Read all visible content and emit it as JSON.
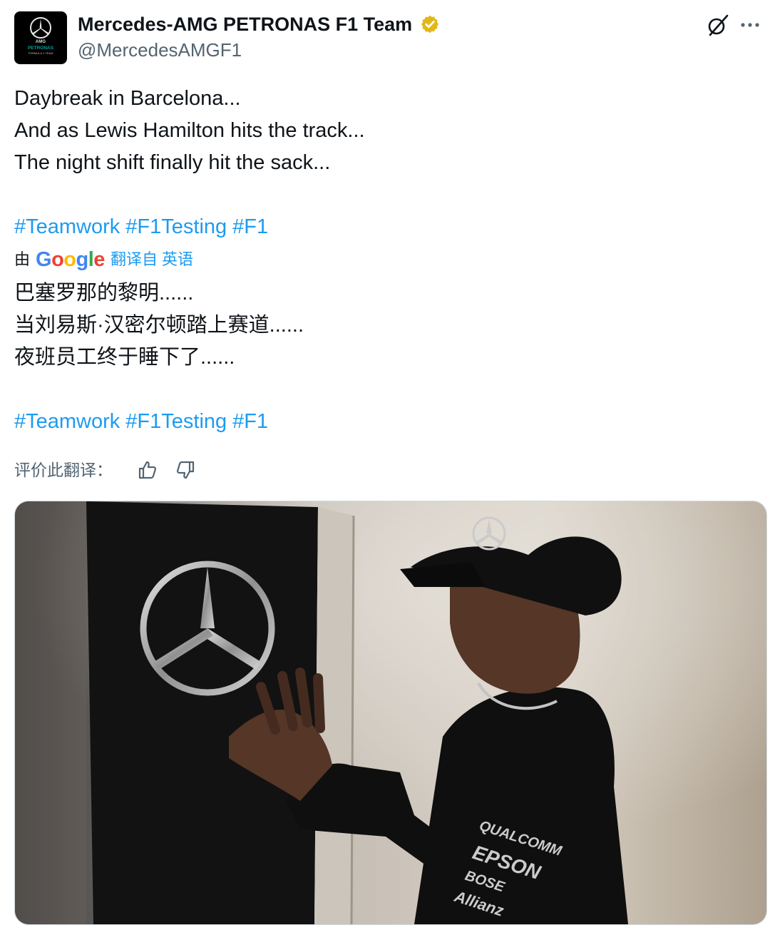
{
  "account": {
    "display_name": "Mercedes-AMG PETRONAS F1 Team",
    "handle": "@MercedesAMGF1",
    "avatar_lines": {
      "amg": "AMG",
      "petronas": "PETRONAS",
      "formula": "FORMULA 1 TEAM"
    },
    "verified_color": "#e2b719"
  },
  "actions": {
    "grok_icon": "grok-icon",
    "more_icon": "more-icon"
  },
  "tweet": {
    "lines": [
      "Daybreak in Barcelona...",
      "And as Lewis Hamilton hits the track...",
      "The night shift finally hit the sack..."
    ],
    "hashtags": [
      "#Teamwork",
      "#F1Testing",
      "#F1"
    ]
  },
  "translation": {
    "by_label": "由",
    "google_label": "Google",
    "link_label": "翻译自 英语",
    "lines": [
      "巴塞罗那的黎明......",
      "当刘易斯·汉密尔顿踏上赛道......",
      "夜班员工终于睡下了......"
    ],
    "hashtags": [
      "#Teamwork",
      "#F1Testing",
      "#F1"
    ],
    "rate_label": "评价此翻译："
  },
  "colors": {
    "link": "#1d9bf0",
    "text": "#0f1419",
    "secondary": "#536471"
  }
}
